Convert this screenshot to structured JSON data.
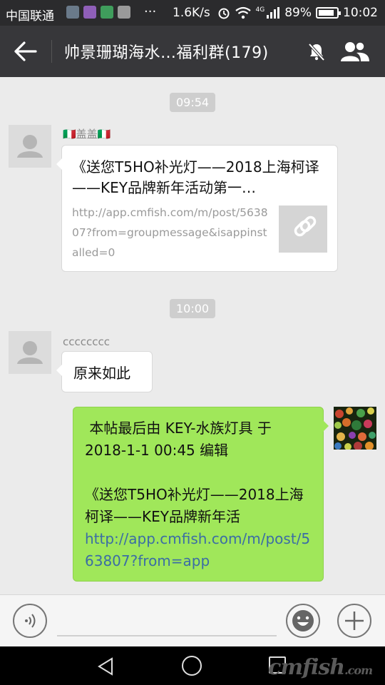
{
  "status_bar": {
    "carrier": "中国联通",
    "more": "···",
    "speed": "1.6K/s",
    "network": "4G",
    "battery": "89%",
    "battery_level": 0.89,
    "time": "10:02"
  },
  "header": {
    "title": "帅景珊瑚海水…福利群(179)"
  },
  "messages": [
    {
      "time": "09:54",
      "sender": "🇮🇹盖盖🇮🇹",
      "link_title": "《送您T5HO补光灯——2018上海柯译——KEY品牌新年活动第一…",
      "link_url": "http://app.cmfish.com/m/post/563807?from=groupmessage&isappinstalled=0"
    },
    {
      "time": "10:00",
      "sender": "cccccccc",
      "text": "原来如此"
    },
    {
      "line1": " 本帖最后由 KEY-水族灯具 于 2018-1-1 00:45 编辑",
      "line2": "《送您T5HO补光灯——2018上海柯译——KEY品牌新年活",
      "link": "http://app.cmfish.com/m/post/563807?from=app"
    }
  ],
  "watermark": {
    "main": "cmfish",
    "suffix": ".com"
  },
  "icons": {
    "back": "arrow-left-icon",
    "mute": "bell-off-icon",
    "members": "people-icon",
    "voice": "voice-icon",
    "emoji": "smile-icon",
    "plus": "plus-icon"
  }
}
